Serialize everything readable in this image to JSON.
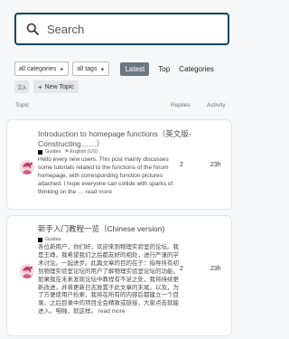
{
  "search": {
    "placeholder": "Search"
  },
  "nav": {
    "categories_dropdown": "all categories",
    "tags_dropdown": "all tags",
    "tab_latest": "Latest",
    "tab_top": "Top",
    "tab_categories": "Categories"
  },
  "actions": {
    "translate_label": "文A",
    "new_topic_label": "New Topic"
  },
  "columns": {
    "topic": "Topic",
    "replies": "Replies",
    "activity": "Activity"
  },
  "topics": [
    {
      "title": "Introduction to homepage functions（英文版-Constructing……）",
      "category": "Guides",
      "tag": "English (US)",
      "excerpt": "Hello every new users. This post mainly discusses some tutorials related to the functions of the forum homepage, with corresponding function pictures attached. I hope everyone can collide with sparks of thinking on the …",
      "read_more": "read more",
      "replies": "2",
      "activity": "23h"
    },
    {
      "title": "新手入门教程一览（Chinese version)",
      "category": "Guides",
      "excerpt": "各位新用户，你们好，欢迎来到物理实验室的论坛。我是王峥，我希望我们之后都友好的相处，进行严谨的学术讨论。一起进步。此篇文章的目的在于：指导所有初到物理实验室论坛的用户了解物理实验室论坛的功能。如果我在未来发现论坛中教程有不足之处，我将持续更新改进，并将更新日志放置于此文章的末尾。以及，为了方便使用户检索，我将在所有的内容后都建立一个目录。之后目录中的项目全会精致或链接，大家点击就能进入。咱啪，就这样。",
      "read_more": "read more",
      "replies": "2",
      "activity": "23h"
    }
  ],
  "colors": {
    "accent": "#0f4463",
    "active_tab": "#6d7780",
    "category_square": "#111111"
  }
}
